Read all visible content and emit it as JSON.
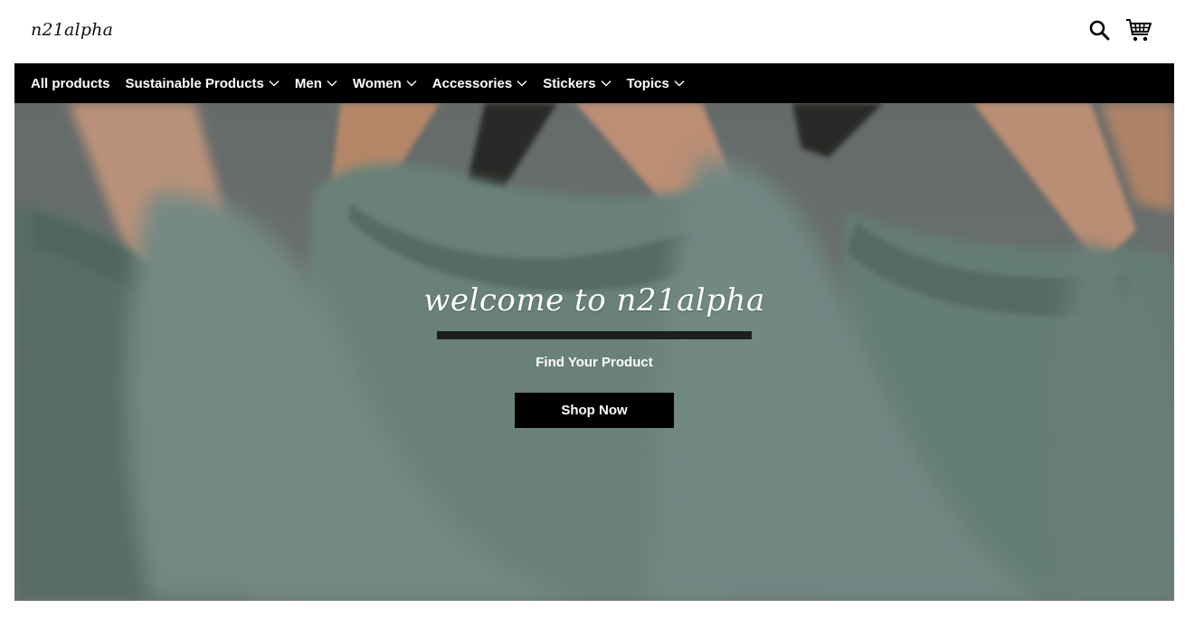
{
  "header": {
    "logo_text": "n21alpha",
    "icons": [
      "search-icon",
      "cart-icon"
    ]
  },
  "nav": {
    "items": [
      {
        "label": "All products",
        "has_dropdown": false
      },
      {
        "label": "Sustainable Products",
        "has_dropdown": true
      },
      {
        "label": "Men",
        "has_dropdown": true
      },
      {
        "label": "Women",
        "has_dropdown": true
      },
      {
        "label": "Accessories",
        "has_dropdown": true
      },
      {
        "label": "Stickers",
        "has_dropdown": true
      },
      {
        "label": "Topics",
        "has_dropdown": true
      }
    ]
  },
  "hero": {
    "title": "welcome to n21alpha",
    "subtitle": "Find Your Product",
    "button_label": "Shop Now"
  },
  "colors": {
    "nav_bg": "#000000",
    "nav_text": "#ffffff",
    "button_bg": "#000000",
    "hero_shirt": "#6a8179"
  }
}
